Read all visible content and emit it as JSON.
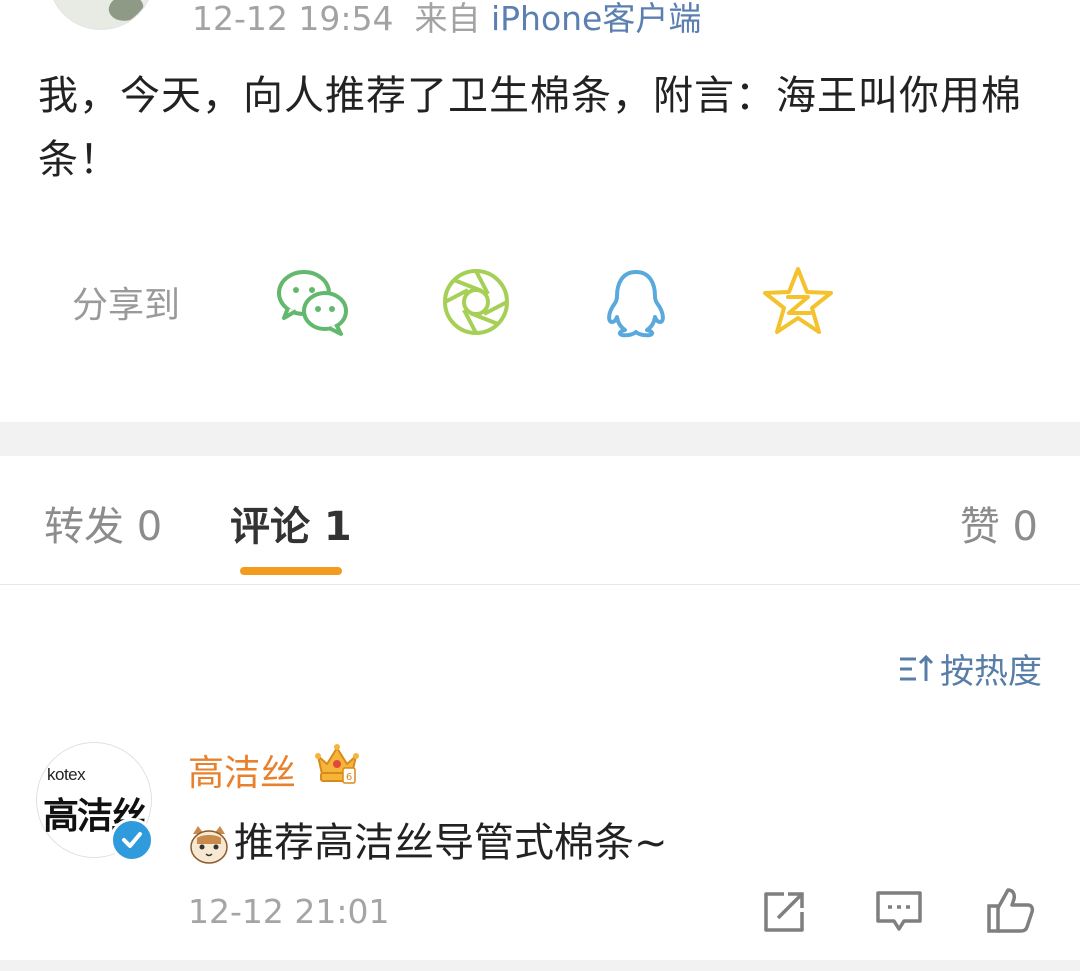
{
  "post": {
    "time": "12-12 19:54",
    "source_prefix": "来自",
    "source": "iPhone客户端",
    "text": "我，今天，向人推荐了卫生棉条，附言：海王叫你用棉条！"
  },
  "share": {
    "label": "分享到",
    "targets": [
      "wechat-icon",
      "moments-icon",
      "qq-icon",
      "qzone-icon"
    ]
  },
  "tabs": [
    {
      "label": "转发 0",
      "active": false
    },
    {
      "label": "评论 1",
      "active": true
    },
    {
      "label": "赞 0",
      "active": false
    }
  ],
  "sort": {
    "label": "按热度"
  },
  "comment": {
    "user": "高洁丝",
    "avatar_logo": "kotex",
    "avatar_brand": "高洁丝",
    "text": "推荐高洁丝导管式棉条~",
    "time": "12-12 21:01"
  },
  "colors": {
    "accent": "#f29b1f",
    "username": "#e8812d",
    "link": "#587ea8",
    "wechat": "#62b86c",
    "moments": "#a6cf56",
    "qq": "#5aa9dd",
    "qzone": "#f3c22c"
  }
}
